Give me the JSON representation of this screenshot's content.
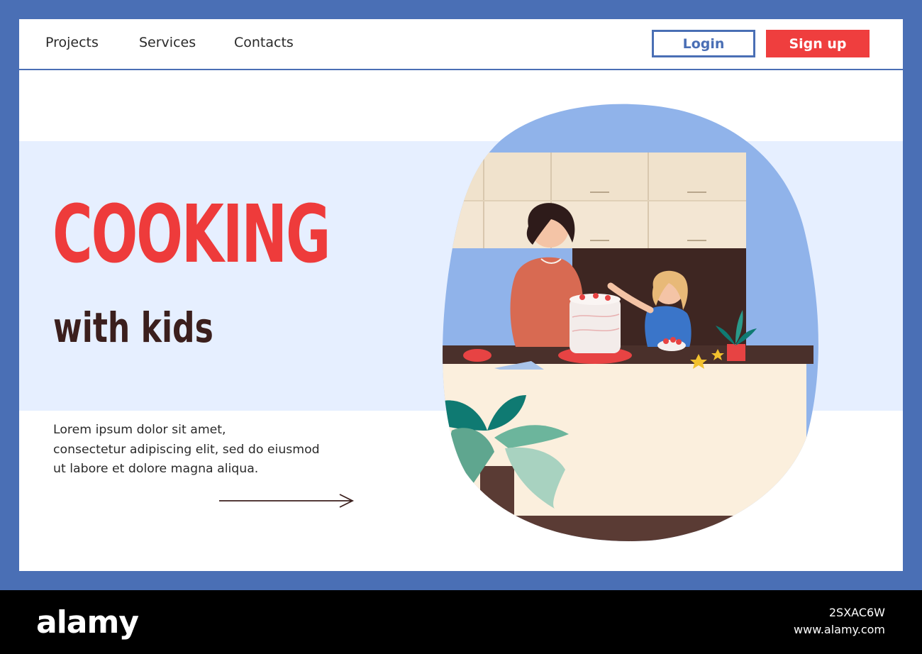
{
  "nav": {
    "items": [
      "Projects",
      "Services",
      "Contacts"
    ],
    "login_label": "Login",
    "signup_label": "Sign up"
  },
  "hero": {
    "title": "COOKING",
    "subtitle": "with kids",
    "body_lines": [
      "Lorem ipsum dolor sit amet,",
      "consectetur adipiscing elit, sed do eiusmod",
      "ut labore et dolore magna aliqua."
    ],
    "arrow_icon": "arrow-right-icon"
  },
  "footer": {
    "logo": "alamy",
    "image_id": "2SXAC6W",
    "url": "www.alamy.com"
  },
  "colors": {
    "frame": "#4a6fb5",
    "accent_red": "#ef3e3e",
    "title_dark": "#3b1f1d",
    "band": "#e6efff"
  }
}
